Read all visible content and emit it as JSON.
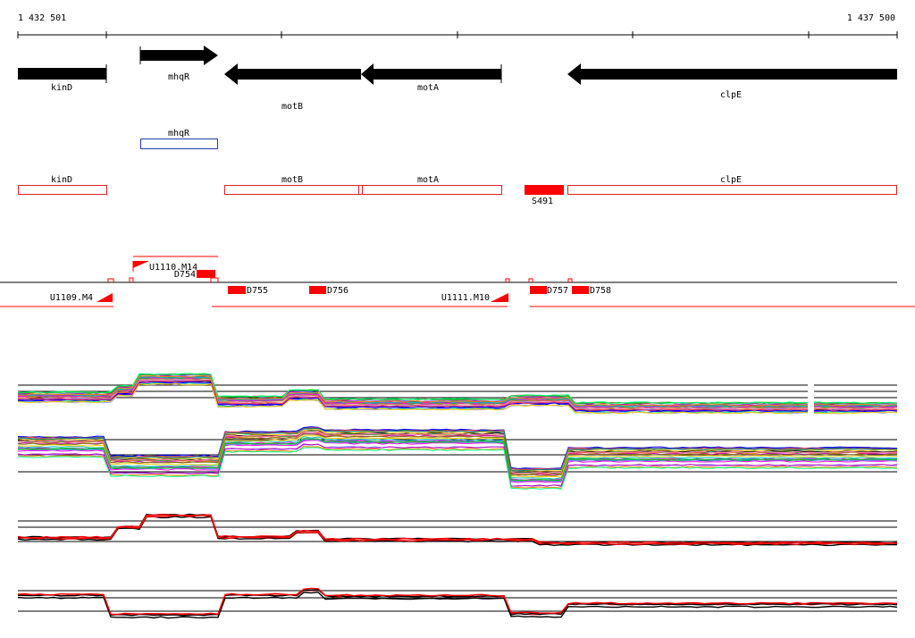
{
  "ruler": {
    "start_label": "1 432 501",
    "end_label": "1 437 500"
  },
  "genes": [
    {
      "name": "kinD",
      "strand": "-"
    },
    {
      "name": "mhqR",
      "strand": "+"
    },
    {
      "name": "motB",
      "strand": "-"
    },
    {
      "name": "motA",
      "strand": "-"
    },
    {
      "name": "clpE",
      "strand": "-"
    }
  ],
  "annotation_boxes": [
    {
      "name": "mhqR",
      "color": "#1f3fa8"
    },
    {
      "name": "kinD",
      "color": "#e02020"
    },
    {
      "name": "motB",
      "color": "#e02020"
    },
    {
      "name": "motA",
      "color": "#e02020"
    },
    {
      "name": "clpE",
      "color": "#e02020"
    }
  ],
  "small_rna": {
    "label": "S491",
    "color": "#ff0000"
  },
  "features": [
    {
      "label": "U1110.M14"
    },
    {
      "label": "D754"
    },
    {
      "label": "U1109.M4"
    },
    {
      "label": "D755"
    },
    {
      "label": "D756"
    },
    {
      "label": "U1111.M10"
    },
    {
      "label": "D757"
    },
    {
      "label": "D758"
    }
  ],
  "colors": {
    "gene": "#000000",
    "feature": "#ff0000",
    "track_line": "#000000"
  }
}
